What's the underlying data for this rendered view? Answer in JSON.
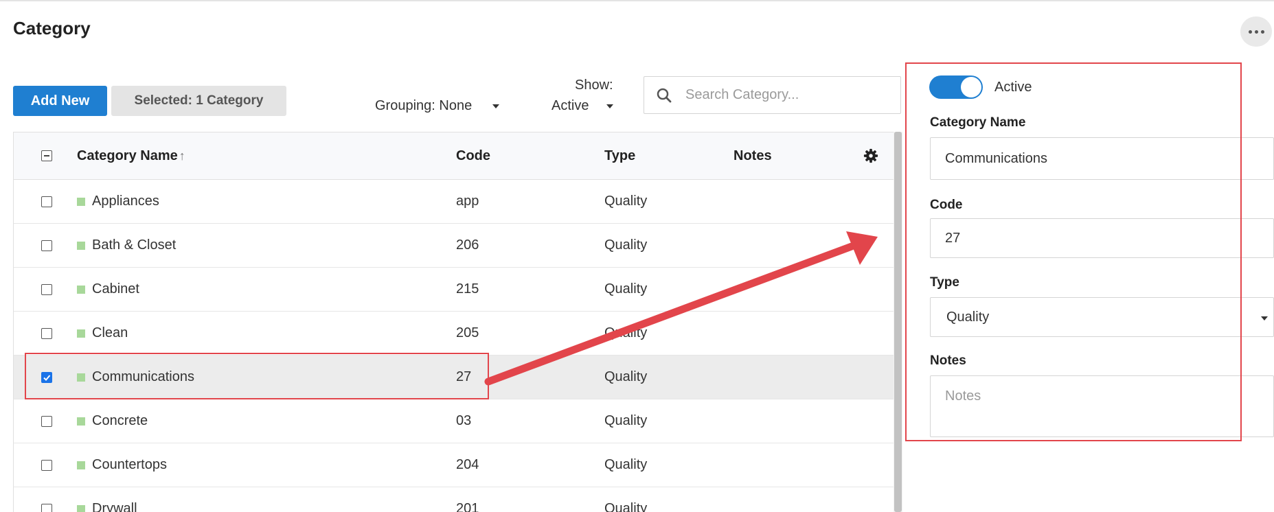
{
  "page": {
    "title": "Category"
  },
  "toolbar": {
    "add_new_label": "Add New",
    "selected_label": "Selected: 1 Category",
    "grouping_label": "Grouping: None",
    "show_label": "Show:",
    "show_value": "Active",
    "search_placeholder": "Search Category..."
  },
  "table": {
    "columns": {
      "name": "Category Name",
      "code": "Code",
      "type": "Type",
      "notes": "Notes"
    },
    "rows": [
      {
        "name": "Appliances",
        "code": "app",
        "type": "Quality",
        "checked": false
      },
      {
        "name": "Bath & Closet",
        "code": "206",
        "type": "Quality",
        "checked": false
      },
      {
        "name": "Cabinet",
        "code": "215",
        "type": "Quality",
        "checked": false
      },
      {
        "name": "Clean",
        "code": "205",
        "type": "Quality",
        "checked": false
      },
      {
        "name": "Communications",
        "code": "27",
        "type": "Quality",
        "checked": true
      },
      {
        "name": "Concrete",
        "code": "03",
        "type": "Quality",
        "checked": false
      },
      {
        "name": "Countertops",
        "code": "204",
        "type": "Quality",
        "checked": false
      },
      {
        "name": "Drywall",
        "code": "201",
        "type": "Quality",
        "checked": false
      }
    ]
  },
  "detail": {
    "active_label": "Active",
    "active": true,
    "category_name_label": "Category Name",
    "category_name_value": "Communications",
    "code_label": "Code",
    "code_value": "27",
    "type_label": "Type",
    "type_value": "Quality",
    "notes_label": "Notes",
    "notes_placeholder": "Notes"
  },
  "colors": {
    "accent": "#1f7fd1",
    "annotation": "#e2454b",
    "category_swatch": "#a8d89a"
  },
  "icons": [
    "more-icon",
    "search-icon",
    "sort-up-icon",
    "gear-icon",
    "chevron-down-icon"
  ]
}
